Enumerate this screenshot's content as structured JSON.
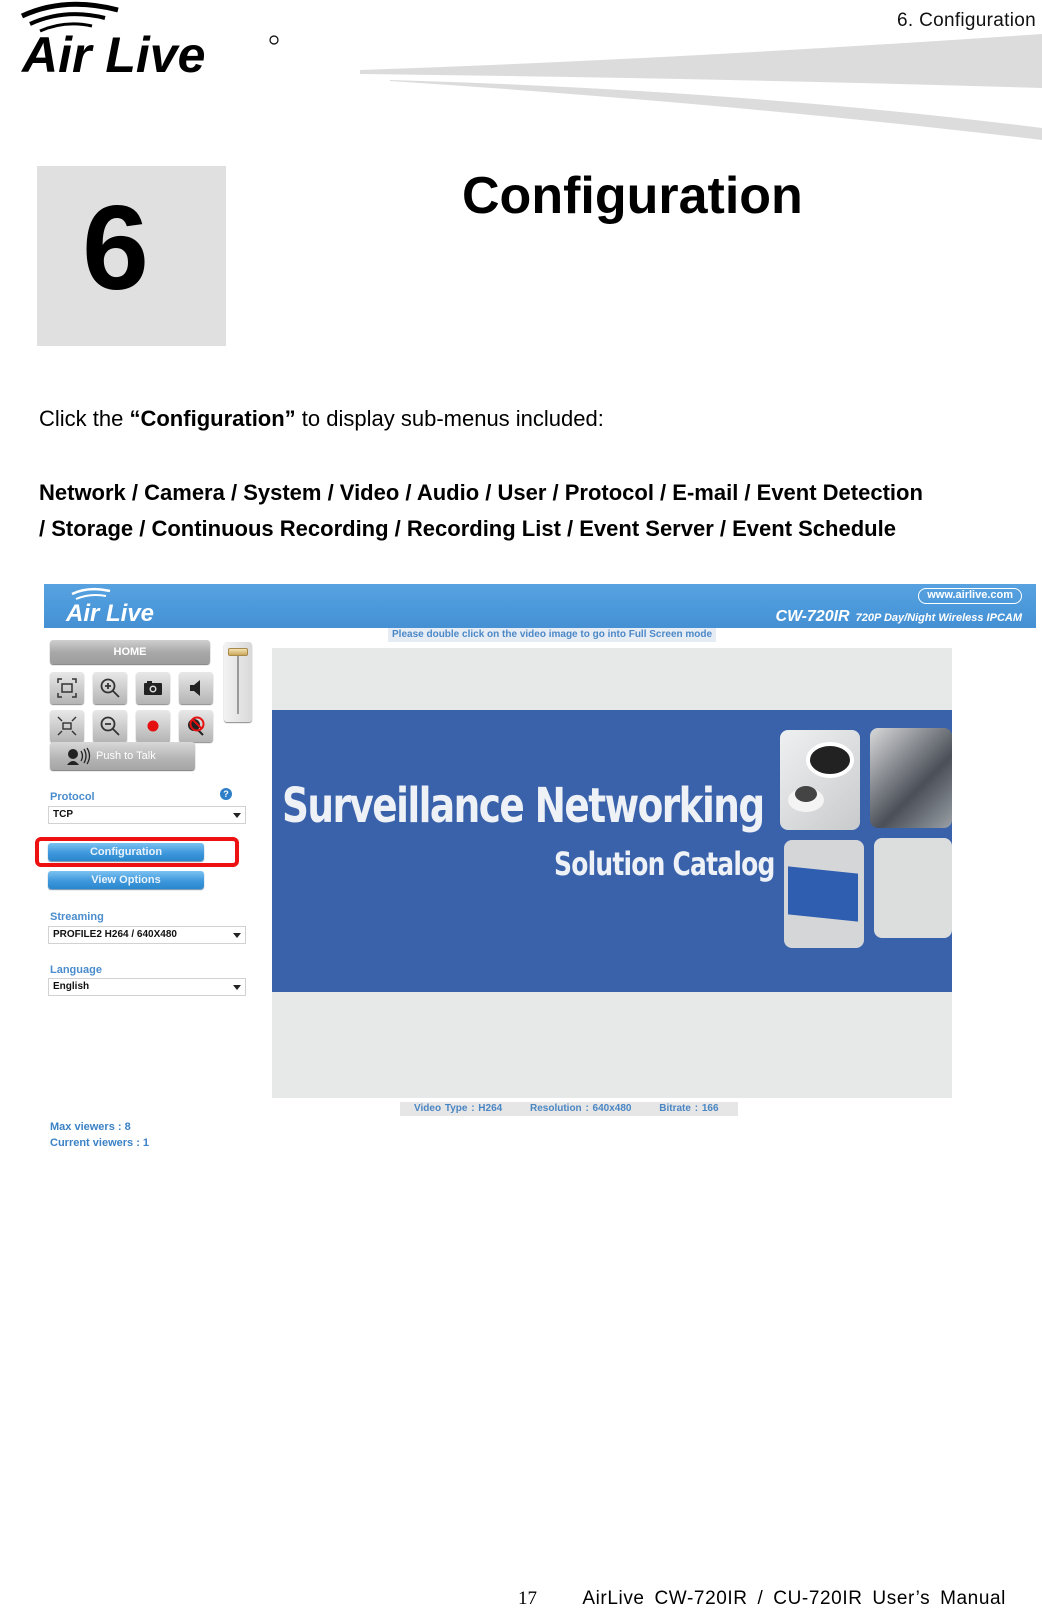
{
  "header": {
    "brand": "Air Live",
    "section_label": "6.  Configuration"
  },
  "chapter": {
    "number": "6",
    "title": "Configuration"
  },
  "body": {
    "intro_prefix": "Click the ",
    "intro_bold": "“Configuration”",
    "intro_suffix": " to display sub-menus included:",
    "submenus_line1": "Network / Camera / System / Video / Audio / User / Protocol / E-mail / Event Detection",
    "submenus_line2": "/ Storage / Continuous Recording / Recording List / Event Server / Event Schedule"
  },
  "screenshot": {
    "banner": {
      "brand": "Air Live",
      "url": "www.airlive.com",
      "model": "CW-720IR",
      "model_desc": "720P Day/Night Wireless IPCAM",
      "color": "#4a98da"
    },
    "home_label": "HOME",
    "controls": [
      {
        "icon": "fullscreen-icon"
      },
      {
        "icon": "zoom-in-icon"
      },
      {
        "icon": "snapshot-camera-icon"
      },
      {
        "icon": "speaker-icon"
      },
      {
        "icon": "shrink-icon"
      },
      {
        "icon": "zoom-out-icon"
      },
      {
        "icon": "record-icon"
      },
      {
        "icon": "mute-microphone-icon"
      }
    ],
    "push_to_talk_label": "Push to Talk",
    "protocol": {
      "label": "Protocol",
      "value": "TCP"
    },
    "configuration_button": "Configuration",
    "view_options_button": "View Options",
    "streaming": {
      "label": "Streaming",
      "value": "PROFILE2 H264 / 640X480"
    },
    "language": {
      "label": "Language",
      "value": "English"
    },
    "max_viewers": "Max viewers : 8",
    "current_viewers": "Current viewers : 1",
    "fullscreen_hint": "Please double click on the video image to go into Full Screen mode",
    "video_text_line1": "Surveillance Networking",
    "video_text_line2": "Solution Catalog",
    "video_status": {
      "video_type": "Video Type : H264",
      "resolution": "Resolution : 640x480",
      "bitrate": "Bitrate : 166"
    },
    "highlight_color": "#ee1111"
  },
  "footer": {
    "page_number": "17",
    "manual_title": "AirLive  CW-720IR  /  CU-720IR  User’s  Manual"
  }
}
